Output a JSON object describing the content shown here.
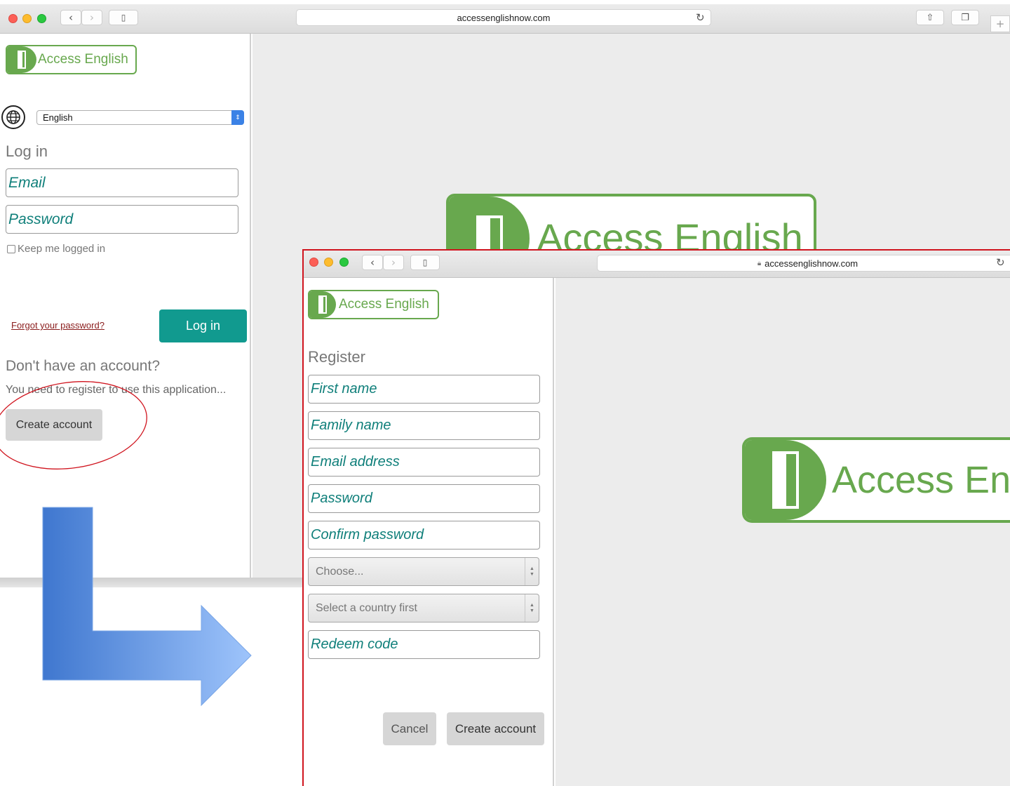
{
  "back_window": {
    "url": "accessenglishnow.com",
    "logo_text": "Access English",
    "language_select": "English",
    "login_heading": "Log in",
    "email_placeholder": "Email",
    "password_placeholder": "Password",
    "keep_logged_in": "Keep me logged in",
    "forgot_password": "Forgot your password?",
    "login_button": "Log in",
    "no_account_heading": "Don't have an account?",
    "register_note": "You need to register to use this application...",
    "create_account_button": "Create account",
    "big_logo_text": "Access English"
  },
  "front_window": {
    "url": "accessenglishnow.com",
    "logo_text": "Access English",
    "register_heading": "Register",
    "fields": {
      "first_name": "First name",
      "family_name": "Family name",
      "email": "Email address",
      "password": "Password",
      "confirm_password": "Confirm password",
      "redeem_code": "Redeem code"
    },
    "country_select": "Choose...",
    "region_select": "Select a country first",
    "cancel_button": "Cancel",
    "create_account_button": "Create account",
    "big_logo_text": "Access En"
  },
  "colors": {
    "brand_green": "#68a84e",
    "teal_button": "#119a8f",
    "input_text": "#0f7f7a",
    "annotation_red": "#d0141e",
    "arrow_blue": "#4f86d8"
  }
}
